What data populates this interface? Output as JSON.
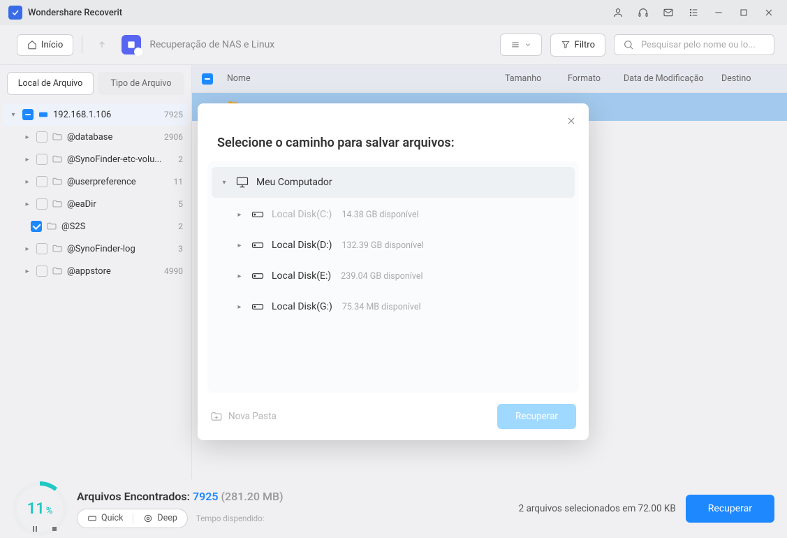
{
  "app": {
    "title": "Wondershare Recoverit"
  },
  "toolbar": {
    "home": "Início",
    "breadcrumb": "Recuperação de NAS e Linux",
    "filter": "Filtro",
    "search_placeholder": "Pesquisar pelo nome ou lo..."
  },
  "sidebar": {
    "tabs": {
      "location": "Local de Arquivo",
      "type": "Tipo de Arquivo"
    },
    "root": {
      "label": "192.168.1.106",
      "count": "7925"
    },
    "items": [
      {
        "label": "@database",
        "count": "2906"
      },
      {
        "label": "@SynoFinder-etc-volu...",
        "count": "2"
      },
      {
        "label": "@userpreference",
        "count": "11"
      },
      {
        "label": "@eaDir",
        "count": "5"
      },
      {
        "label": "@S2S",
        "count": "2",
        "checked": true
      },
      {
        "label": "@SynoFinder-log",
        "count": "3"
      },
      {
        "label": "@appstore",
        "count": "4990"
      }
    ]
  },
  "columns": {
    "name": "Nome",
    "size": "Tamanho",
    "format": "Formato",
    "date": "Data de Modificação",
    "dest": "Destino"
  },
  "modal": {
    "title": "Selecione o caminho para salvar arquivos:",
    "root": "Meu Computador",
    "disks": [
      {
        "label": "Local Disk(C:)",
        "avail": "14.38 GB disponível",
        "disabled": true
      },
      {
        "label": "Local Disk(D:)",
        "avail": "132.39 GB disponível"
      },
      {
        "label": "Local Disk(E:)",
        "avail": "239.04 GB disponível"
      },
      {
        "label": "Local Disk(G:)",
        "avail": "75.34 MB disponível"
      }
    ],
    "new_folder": "Nova Pasta",
    "recover": "Recuperar"
  },
  "footer": {
    "progress": "11",
    "found_label": "Arquivos Encontrados:",
    "found_count": "7925",
    "found_size": "(281.20 MB)",
    "quick": "Quick",
    "deep": "Deep",
    "time": "Tempo dispendido:",
    "selected": "2 arquivos selecionados em 72.00 KB",
    "recover": "Recuperar"
  }
}
